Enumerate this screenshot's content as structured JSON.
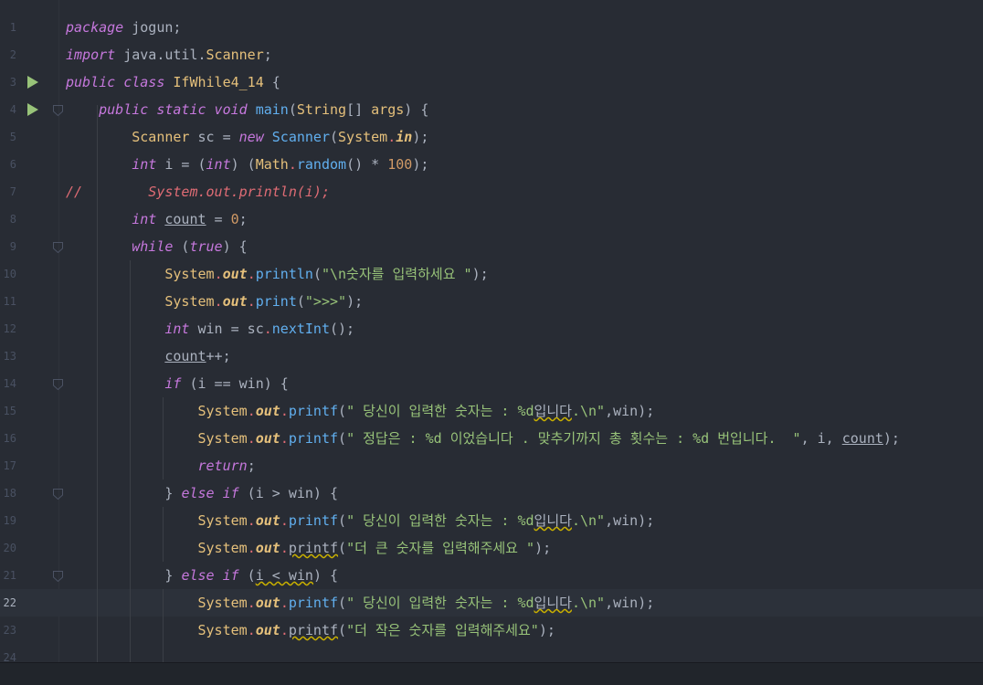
{
  "editor": {
    "current_line": 22,
    "lines": [
      {
        "n": "1",
        "code": [
          [
            "kw",
            "package"
          ],
          [
            "plain",
            " "
          ],
          [
            "plain",
            "jogun;"
          ]
        ]
      },
      {
        "n": "2",
        "code": [
          [
            "kw",
            "import"
          ],
          [
            "plain",
            " java.util."
          ],
          [
            "cls",
            "Scanner"
          ],
          [
            "plain",
            ";"
          ]
        ]
      },
      {
        "n": "3",
        "code": [
          [
            "kw",
            "public class"
          ],
          [
            "plain",
            " "
          ],
          [
            "cls",
            "IfWhile4_14"
          ],
          [
            "plain",
            " {"
          ]
        ]
      },
      {
        "n": "4",
        "code": [
          [
            "plain",
            "    "
          ],
          [
            "kw",
            "public static void"
          ],
          [
            "plain",
            " "
          ],
          [
            "fn",
            "main"
          ],
          [
            "plain",
            "("
          ],
          [
            "cls",
            "String"
          ],
          [
            "plain",
            "[] "
          ],
          [
            "param",
            "args"
          ],
          [
            "plain",
            ") {"
          ]
        ]
      },
      {
        "n": "5",
        "code": [
          [
            "plain",
            "        "
          ],
          [
            "cls",
            "Scanner"
          ],
          [
            "plain",
            " sc = "
          ],
          [
            "kw",
            "new"
          ],
          [
            "plain",
            " "
          ],
          [
            "fn",
            "Scanner"
          ],
          [
            "plain",
            "("
          ],
          [
            "cls",
            "System"
          ],
          [
            "dot",
            "."
          ],
          [
            "field",
            "in"
          ],
          [
            "plain",
            ");"
          ]
        ]
      },
      {
        "n": "6",
        "code": [
          [
            "plain",
            "        "
          ],
          [
            "kw",
            "int"
          ],
          [
            "plain",
            " i = ("
          ],
          [
            "kw",
            "int"
          ],
          [
            "plain",
            ") ("
          ],
          [
            "cls",
            "Math"
          ],
          [
            "dot",
            "."
          ],
          [
            "fn",
            "random"
          ],
          [
            "plain",
            "() * "
          ],
          [
            "num",
            "100"
          ],
          [
            "plain",
            ");"
          ]
        ]
      },
      {
        "n": "7",
        "code": [
          [
            "cmt",
            "//        System.out.println(i);"
          ]
        ]
      },
      {
        "n": "8",
        "code": [
          [
            "plain",
            "        "
          ],
          [
            "kw",
            "int"
          ],
          [
            "plain",
            " "
          ],
          [
            "ul",
            "count"
          ],
          [
            "plain",
            " = "
          ],
          [
            "num",
            "0"
          ],
          [
            "plain",
            ";"
          ]
        ]
      },
      {
        "n": "9",
        "code": [
          [
            "plain",
            "        "
          ],
          [
            "kw",
            "while"
          ],
          [
            "plain",
            " ("
          ],
          [
            "kw",
            "true"
          ],
          [
            "plain",
            ") {"
          ]
        ]
      },
      {
        "n": "10",
        "code": [
          [
            "plain",
            "            "
          ],
          [
            "cls",
            "System"
          ],
          [
            "dot",
            "."
          ],
          [
            "field",
            "out"
          ],
          [
            "dot",
            "."
          ],
          [
            "fn",
            "println"
          ],
          [
            "plain",
            "("
          ],
          [
            "str",
            "\"\\n숫자를 입력하세요 \""
          ],
          [
            "plain",
            ");"
          ]
        ]
      },
      {
        "n": "11",
        "code": [
          [
            "plain",
            "            "
          ],
          [
            "cls",
            "System"
          ],
          [
            "dot",
            "."
          ],
          [
            "field",
            "out"
          ],
          [
            "dot",
            "."
          ],
          [
            "fn",
            "print"
          ],
          [
            "plain",
            "("
          ],
          [
            "str",
            "\">>>\""
          ],
          [
            "plain",
            ");"
          ]
        ]
      },
      {
        "n": "12",
        "code": [
          [
            "plain",
            "            "
          ],
          [
            "kw",
            "int"
          ],
          [
            "plain",
            " win = sc"
          ],
          [
            "dot",
            "."
          ],
          [
            "fn",
            "nextInt"
          ],
          [
            "plain",
            "();"
          ]
        ]
      },
      {
        "n": "13",
        "code": [
          [
            "plain",
            "            "
          ],
          [
            "ul",
            "count"
          ],
          [
            "plain",
            "++;"
          ]
        ]
      },
      {
        "n": "14",
        "code": [
          [
            "plain",
            "            "
          ],
          [
            "kw",
            "if"
          ],
          [
            "plain",
            " (i == win) {"
          ]
        ]
      },
      {
        "n": "15",
        "code": [
          [
            "plain",
            "                "
          ],
          [
            "cls",
            "System"
          ],
          [
            "dot",
            "."
          ],
          [
            "field",
            "out"
          ],
          [
            "dot",
            "."
          ],
          [
            "fn",
            "printf"
          ],
          [
            "plain",
            "("
          ],
          [
            "str",
            "\" 당신이 입력한 숫자는 : %d"
          ],
          [
            "warn",
            "입니다"
          ],
          [
            "str",
            ".\\n\""
          ],
          [
            "plain",
            ",win);"
          ]
        ]
      },
      {
        "n": "16",
        "code": [
          [
            "plain",
            "                "
          ],
          [
            "cls",
            "System"
          ],
          [
            "dot",
            "."
          ],
          [
            "field",
            "out"
          ],
          [
            "dot",
            "."
          ],
          [
            "fn",
            "printf"
          ],
          [
            "plain",
            "("
          ],
          [
            "str",
            "\" 정답은 : %d 이었습니다 . 맞추기까지 총 횟수는 : %d 번입니다.  \""
          ],
          [
            "plain",
            ", i, "
          ],
          [
            "ul",
            "count"
          ],
          [
            "plain",
            ");"
          ]
        ]
      },
      {
        "n": "17",
        "code": [
          [
            "plain",
            "                "
          ],
          [
            "kw",
            "return"
          ],
          [
            "plain",
            ";"
          ]
        ]
      },
      {
        "n": "18",
        "code": [
          [
            "plain",
            "            } "
          ],
          [
            "kw",
            "else if"
          ],
          [
            "plain",
            " (i > win) {"
          ]
        ]
      },
      {
        "n": "19",
        "code": [
          [
            "plain",
            "                "
          ],
          [
            "cls",
            "System"
          ],
          [
            "dot",
            "."
          ],
          [
            "field",
            "out"
          ],
          [
            "dot",
            "."
          ],
          [
            "fn",
            "printf"
          ],
          [
            "plain",
            "("
          ],
          [
            "str",
            "\" 당신이 입력한 숫자는 : %d"
          ],
          [
            "warn",
            "입니다"
          ],
          [
            "str",
            ".\\n\""
          ],
          [
            "plain",
            ",win);"
          ]
        ]
      },
      {
        "n": "20",
        "code": [
          [
            "plain",
            "                "
          ],
          [
            "cls",
            "System"
          ],
          [
            "dot",
            "."
          ],
          [
            "field",
            "out"
          ],
          [
            "dot",
            "."
          ],
          [
            "warn",
            "printf"
          ],
          [
            "plain",
            "("
          ],
          [
            "str",
            "\"더 큰 숫자를 입력해주세요 \""
          ],
          [
            "plain",
            ");"
          ]
        ]
      },
      {
        "n": "21",
        "code": [
          [
            "plain",
            "            } "
          ],
          [
            "kw",
            "else if"
          ],
          [
            "plain",
            " ("
          ],
          [
            "warn",
            "i < win"
          ],
          [
            "plain",
            ") {"
          ]
        ]
      },
      {
        "n": "22",
        "code": [
          [
            "plain",
            "                "
          ],
          [
            "cls",
            "System"
          ],
          [
            "dot",
            "."
          ],
          [
            "field",
            "out"
          ],
          [
            "dot",
            "."
          ],
          [
            "fn",
            "printf"
          ],
          [
            "plain",
            "("
          ],
          [
            "str",
            "\" 당신이 입력한 숫자는 : %d"
          ],
          [
            "warn",
            "입니다"
          ],
          [
            "str",
            ".\\n\""
          ],
          [
            "plain",
            ",win);"
          ]
        ]
      },
      {
        "n": "23",
        "code": [
          [
            "plain",
            "                "
          ],
          [
            "cls",
            "System"
          ],
          [
            "dot",
            "."
          ],
          [
            "field",
            "out"
          ],
          [
            "dot",
            "."
          ],
          [
            "warn",
            "printf"
          ],
          [
            "plain",
            "("
          ],
          [
            "str",
            "\"더 작은 숫자를 입력해주세요\""
          ],
          [
            "plain",
            ");"
          ]
        ]
      },
      {
        "n": "24",
        "code": []
      }
    ]
  }
}
